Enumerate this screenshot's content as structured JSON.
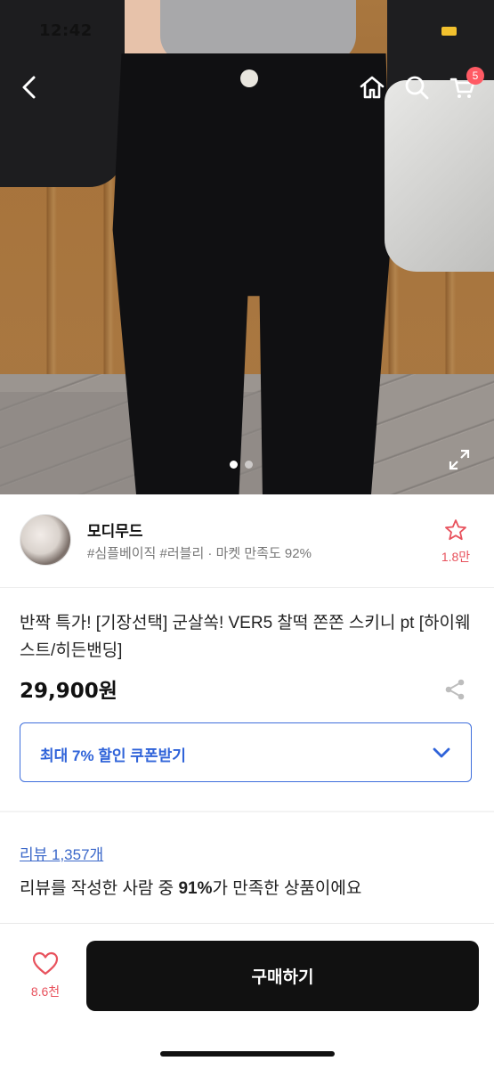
{
  "status_bar": {
    "time": "12:42"
  },
  "nav": {
    "back_icon": "chevron-left-icon",
    "home_icon": "home-icon",
    "search_icon": "search-icon",
    "cart_icon": "cart-icon",
    "cart_count": "5"
  },
  "gallery": {
    "current_index": 1,
    "total": 2,
    "expand_icon": "expand-icon"
  },
  "seller": {
    "name": "모디무드",
    "tags": "#심플베이직 #러블리 · 마켓 만족도 92%",
    "like_count": "1.8만"
  },
  "product": {
    "title": "반짝 특가! [기장선택] 군살쏙! VER5 찰떡 쫀쫀 스키니 pt [하이웨스트/히든밴딩]",
    "price": "29,900원"
  },
  "coupon": {
    "label": "최대 7% 할인 쿠폰받기"
  },
  "review": {
    "link": "리뷰 1,357개",
    "summary_prefix": "리뷰를 작성한 사람 중 ",
    "summary_percent": "91%",
    "summary_suffix": "가 만족한 상품이에요"
  },
  "bottom_bar": {
    "wish_count": "8.6천",
    "buy_label": "구매하기"
  },
  "colors": {
    "accent_blue": "#2f63d9",
    "like_red": "#e8525d",
    "buy_button": "#111111",
    "cart_badge": "#ff5a64"
  }
}
